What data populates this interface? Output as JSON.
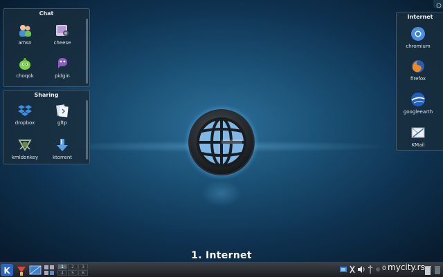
{
  "desktop": {
    "activity_name": "1. Internet"
  },
  "widgets": {
    "chat": {
      "title": "Chat",
      "items": [
        {
          "label": "amsn",
          "icon": "amsn-buddies-icon"
        },
        {
          "label": "cheese",
          "icon": "cheese-webcam-icon"
        },
        {
          "label": "choqok",
          "icon": "choqok-bird-icon"
        },
        {
          "label": "pidgin",
          "icon": "pidgin-icon"
        }
      ]
    },
    "sharing": {
      "title": "Sharing",
      "items": [
        {
          "label": "dropbox",
          "icon": "dropbox-icon"
        },
        {
          "label": "gftp",
          "icon": "gftp-icon"
        },
        {
          "label": "kmldonkey",
          "icon": "kmldonkey-icon"
        },
        {
          "label": "ktorrent",
          "icon": "ktorrent-icon"
        }
      ]
    },
    "internet": {
      "title": "Internet",
      "items": [
        {
          "label": "chromium",
          "icon": "chromium-icon"
        },
        {
          "label": "firefox",
          "icon": "firefox-icon"
        },
        {
          "label": "googleearth",
          "icon": "googleearth-icon"
        },
        {
          "label": "KMail",
          "icon": "kmail-icon"
        }
      ]
    }
  },
  "taskbar": {
    "pager": [
      "1",
      "2",
      "3",
      "4",
      "5",
      "6"
    ],
    "active_desktop": "1",
    "clock": "0",
    "watermark": "mycity.rs"
  }
}
